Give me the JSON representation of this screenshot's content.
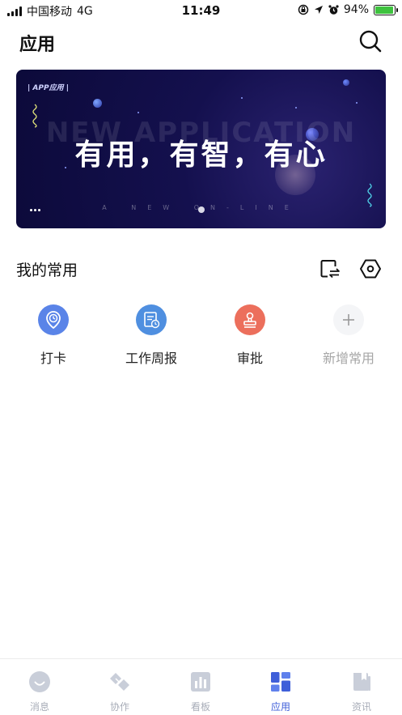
{
  "status_bar": {
    "carrier": "中国移动",
    "network": "4G",
    "time": "11:49",
    "battery": "94%",
    "battery_level": 0.94
  },
  "header": {
    "title": "应用",
    "search_icon": "search-icon"
  },
  "banner": {
    "tag": "| APP应用 |",
    "background_text": "NEW APPLICATION",
    "headline": "有用，有智，有心",
    "subline": "A NEW ON-LINE"
  },
  "favorites": {
    "title": "我的常用",
    "swap_icon": "swap-icon",
    "settings_icon": "settings-icon",
    "apps": [
      {
        "label": "打卡",
        "icon": "location-clock-icon",
        "color": "#5a84e8"
      },
      {
        "label": "工作周报",
        "icon": "report-icon",
        "color": "#4f8fe0"
      },
      {
        "label": "审批",
        "icon": "stamp-icon",
        "color": "#ec6f5c"
      },
      {
        "label": "新增常用",
        "icon": "plus-icon",
        "color": "#f4f5f7"
      }
    ]
  },
  "tabbar": {
    "items": [
      {
        "label": "消息",
        "icon": "message-icon"
      },
      {
        "label": "协作",
        "icon": "collaboration-icon"
      },
      {
        "label": "看板",
        "icon": "dashboard-icon"
      },
      {
        "label": "应用",
        "icon": "apps-icon"
      },
      {
        "label": "资讯",
        "icon": "news-icon"
      }
    ],
    "active_index": 3,
    "active_color": "#3f5fd9",
    "inactive_color": "#c9ced9"
  }
}
